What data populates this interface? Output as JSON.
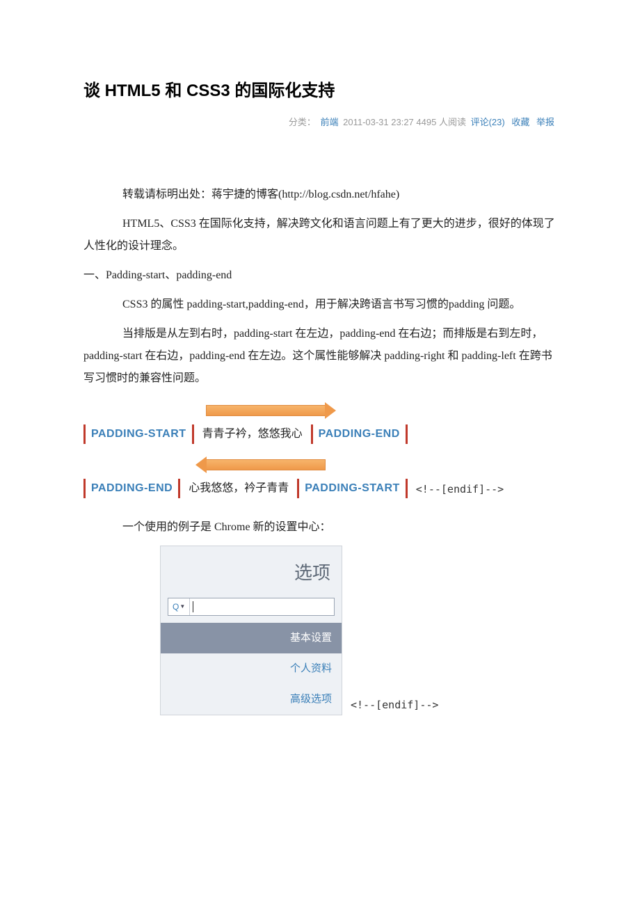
{
  "title": "谈 HTML5 和 CSS3 的国际化支持",
  "meta": {
    "category_label": "分类：",
    "category": "前端",
    "datetime": "2011-03-31 23:27",
    "views": "4495 人阅读",
    "comments": "评论(23)",
    "favorite": "收藏",
    "report": "举报"
  },
  "paras": {
    "source": "转载请标明出处：蒋宇捷的博客(http://blog.csdn.net/hfahe)",
    "intro": "HTML5、CSS3 在国际化支持，解决跨文化和语言问题上有了更大的进步，很好的体现了人性化的设计理念。",
    "section1_title": "一、Padding-start、padding-end",
    "section1_p1": "CSS3 的属性 padding-start,padding-end，用于解决跨语言书写习惯的padding 问题。",
    "section1_p2": "当排版是从左到右时，padding-start 在左边，padding-end 在右边；而排版是右到左时，padding-start 在右边，padding-end 在左边。这个属性能够解决 padding-right 和 padding-left 在跨书写习惯时的兼容性问题。",
    "example_intro": "一个使用的例子是 Chrome 新的设置中心：",
    "endif": "<!--[endif]-->"
  },
  "diagram": {
    "padding_start": "PADDING-START",
    "padding_end": "PADDING-END",
    "ltr_text": "青青子衿，悠悠我心",
    "rtl_text": "心我悠悠，衿子青青"
  },
  "chrome": {
    "title": "选项",
    "search_glyph": "Q",
    "items": [
      "基本设置",
      "个人资料",
      "高级选项"
    ]
  }
}
